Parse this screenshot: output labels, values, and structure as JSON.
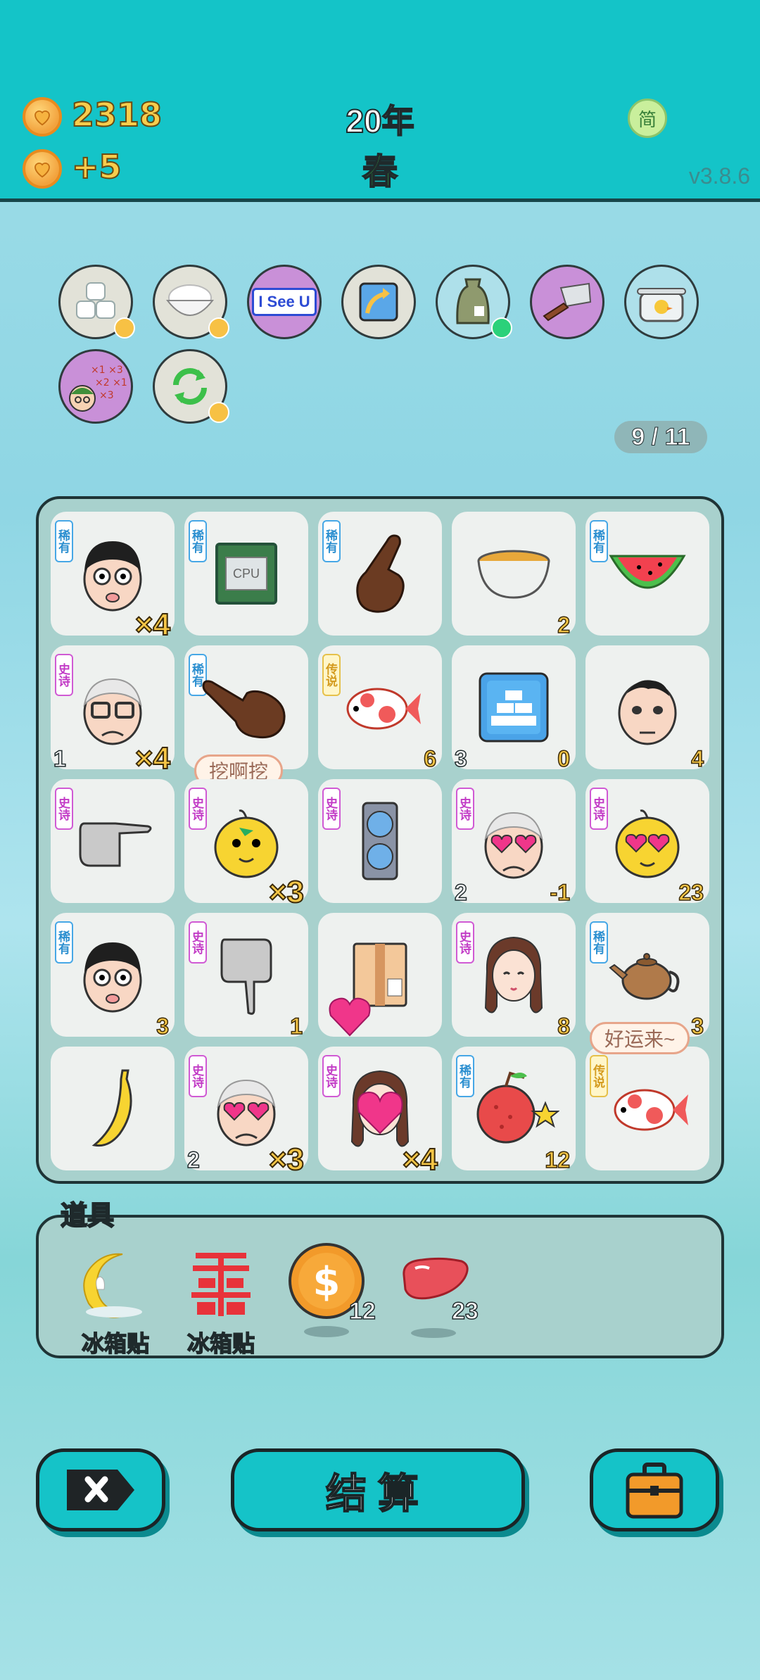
{
  "header": {
    "coins": "2318",
    "income": "+5",
    "year": "20年",
    "season": "春",
    "lang_button": "简",
    "version": "v3.8.6"
  },
  "relics": [
    {
      "name": "ice-cubes",
      "badge": "coin"
    },
    {
      "name": "rice-bowl",
      "badge": "coin"
    },
    {
      "name": "i-see-u",
      "text": "I See U"
    },
    {
      "name": "up-arrow"
    },
    {
      "name": "sack",
      "badge": "green"
    },
    {
      "name": "cleaver"
    },
    {
      "name": "pot-duck"
    },
    {
      "name": "multiplier-guy"
    },
    {
      "name": "refresh",
      "badge": "coin"
    }
  ],
  "page_counter": "9 / 11",
  "board": {
    "tags": {
      "rare": "稀有",
      "epic": "史诗",
      "legend": "传说"
    },
    "cells": [
      {
        "item": "boy-face",
        "tag": "rare",
        "mult": "×4"
      },
      {
        "item": "cpu-chip",
        "tag": "rare",
        "icon_text": "CPU"
      },
      {
        "item": "pointing-finger-up",
        "tag": "rare"
      },
      {
        "item": "soup-bowl",
        "num": "2"
      },
      {
        "item": "watermelon",
        "tag": "rare"
      },
      {
        "item": "grandpa-face",
        "tag": "epic",
        "left": "1",
        "mult": "×4"
      },
      {
        "item": "pointing-finger-right",
        "tag": "rare"
      },
      {
        "item": "koi-fish",
        "tag": "legend",
        "num": "6"
      },
      {
        "item": "gold-bars",
        "left": "3",
        "num": "0"
      },
      {
        "item": "man-face",
        "num": "4"
      },
      {
        "item": "hand-point-right-grey",
        "tag": "epic"
      },
      {
        "item": "chick-face",
        "tag": "epic",
        "mult": "×3",
        "bubble": "挖啊挖"
      },
      {
        "item": "gpu-card",
        "tag": "epic"
      },
      {
        "item": "grandpa-heart-eyes",
        "tag": "epic",
        "left": "2",
        "num": "-1"
      },
      {
        "item": "chick-heart-eyes",
        "tag": "epic",
        "num": "23"
      },
      {
        "item": "boy-face-2",
        "tag": "rare",
        "num": "3"
      },
      {
        "item": "hand-point-down-grey",
        "tag": "epic",
        "num": "1"
      },
      {
        "item": "parcel-box"
      },
      {
        "item": "girl-braids",
        "tag": "epic",
        "num": "8"
      },
      {
        "item": "teapot",
        "tag": "rare",
        "num": "3"
      },
      {
        "item": "banana"
      },
      {
        "item": "grandpa-heart-eyes-2",
        "tag": "epic",
        "left": "2",
        "mult": "×3"
      },
      {
        "item": "girl-heart-face",
        "tag": "epic",
        "mult": "×4"
      },
      {
        "item": "lychee",
        "tag": "rare",
        "num": "12"
      },
      {
        "item": "koi-fish-2",
        "tag": "legend",
        "bubble": "好运来~"
      }
    ]
  },
  "tools": {
    "title": "道具",
    "items": [
      {
        "name": "moon-magnet",
        "label": "冰箱贴"
      },
      {
        "name": "double-happiness-magnet",
        "label": "冰箱贴"
      },
      {
        "name": "dollar-coin",
        "count": "12"
      },
      {
        "name": "liver",
        "count": "23"
      }
    ]
  },
  "buttons": {
    "settle": "结算"
  },
  "colors": {
    "header_bg": "#14c4c8",
    "button_bg": "#15c3c8",
    "number_gold": "#f6c647",
    "tag_rare": "#2c8fd0",
    "tag_epic": "#c23bc6",
    "tag_legend": "#d49b1f"
  }
}
